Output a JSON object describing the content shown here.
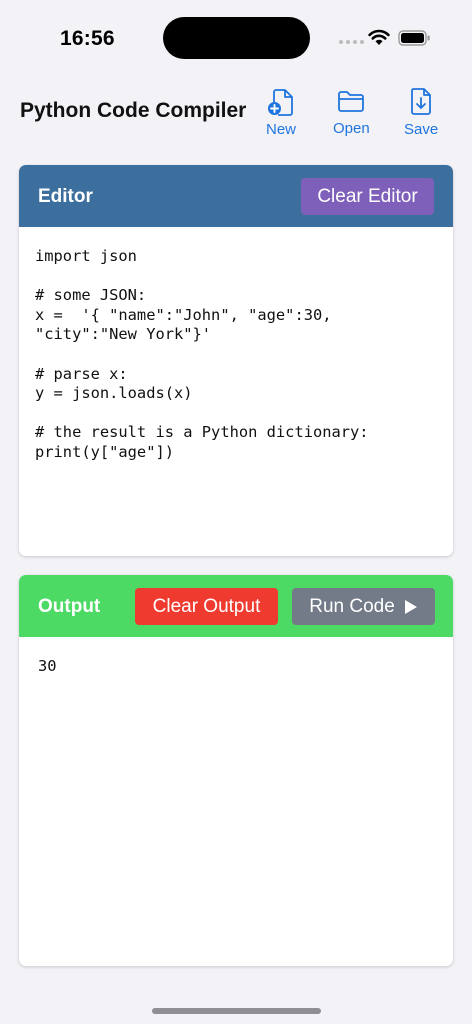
{
  "status_bar": {
    "time": "16:56",
    "icons": [
      "signal-dots-icon",
      "wifi-icon",
      "battery-icon"
    ]
  },
  "toolbar": {
    "title": "Python Code Compiler",
    "new_label": "New",
    "open_label": "Open",
    "save_label": "Save",
    "accent": "#1f75de"
  },
  "editor": {
    "title": "Editor",
    "clear_label": "Clear Editor",
    "header_color": "#3d6f9e",
    "code": "import json\n\n# some JSON:\nx =  '{ \"name\":\"John\", \"age\":30,\n\"city\":\"New York\"}'\n\n# parse x:\ny = json.loads(x)\n\n# the result is a Python dictionary:\nprint(y[\"age\"])"
  },
  "output": {
    "title": "Output",
    "clear_label": "Clear Output",
    "run_label": "Run Code",
    "header_color": "#4cd964",
    "text": "30"
  }
}
